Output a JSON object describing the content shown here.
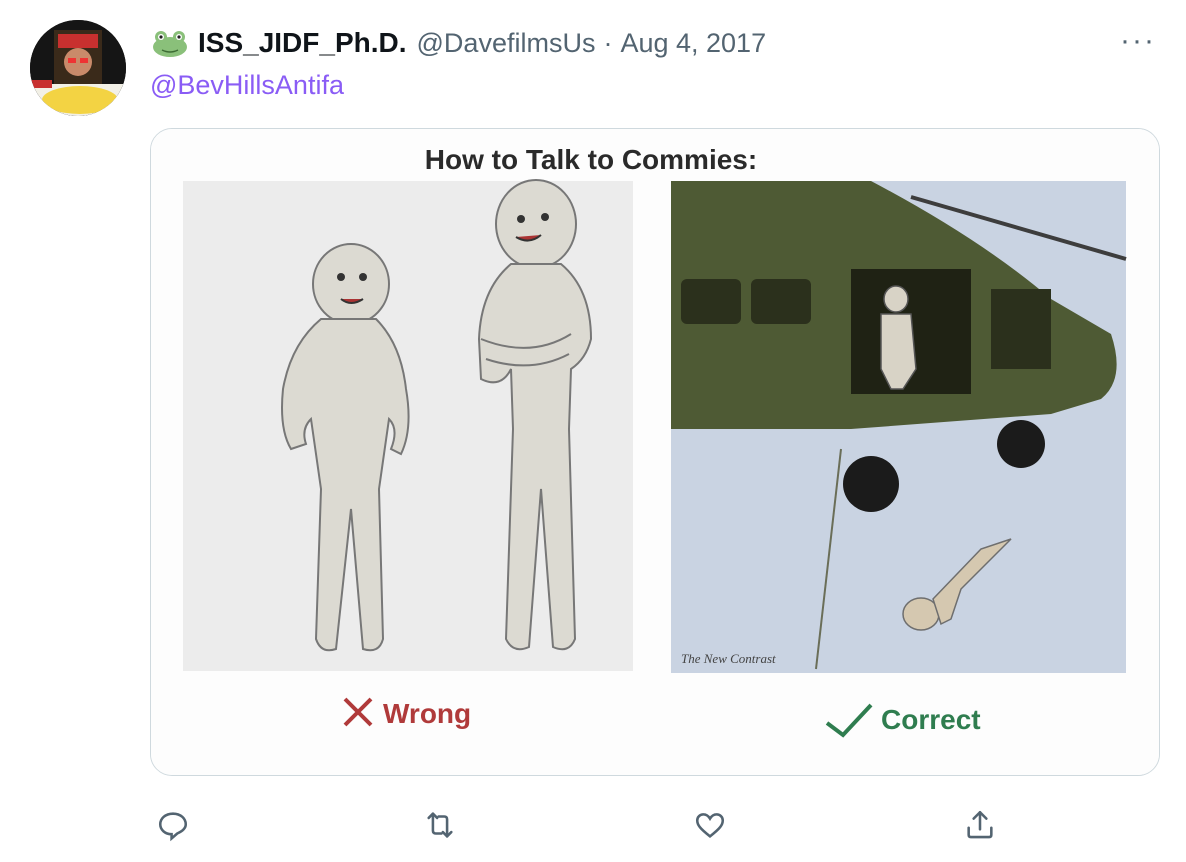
{
  "tweet": {
    "display_name": "ISS_JIDF_Ph.D.",
    "handle": "@DavefilmsUs",
    "separator": "·",
    "date": "Aug 4, 2017",
    "replying_to": "@BevHillsAntifa",
    "more_icon": "more-icon",
    "badge_icon": "frog-emoji-icon"
  },
  "media": {
    "title": "How to Talk to Commies:",
    "left_label": "Wrong",
    "right_label": "Correct",
    "watermark": "The New Contrast"
  },
  "actions": [
    {
      "icon": "reply-icon"
    },
    {
      "icon": "retweet-icon"
    },
    {
      "icon": "like-icon"
    },
    {
      "icon": "share-icon"
    }
  ],
  "colors": {
    "handle_text": "#536471",
    "mention": "#8a5cf5",
    "border": "#cfd9de",
    "wrong": "#b03a3a",
    "correct": "#2f7d4f"
  }
}
